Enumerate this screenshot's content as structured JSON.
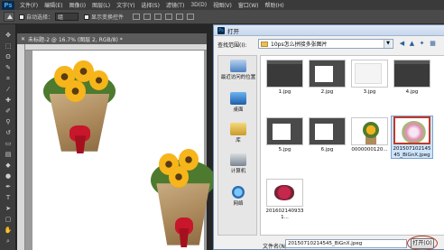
{
  "ps": {
    "logo": "Ps",
    "menu": [
      "文件(F)",
      "编辑(E)",
      "图像(I)",
      "图层(L)",
      "文字(Y)",
      "选择(S)",
      "滤镜(T)",
      "3D(D)",
      "视图(V)",
      "窗口(W)",
      "帮助(H)"
    ],
    "options": {
      "auto_select_label": "自动选择：",
      "auto_select_value": "组",
      "transform_label": "显示变换控件"
    },
    "document_tab": "未标题-2 @ 16.7% (图层 2, RGB/8) *"
  },
  "dialog": {
    "title": "打开",
    "look_in_label": "查找范围(I):",
    "current_folder": "10ps怎么拼接多张图片",
    "places": [
      {
        "label": "最近访问的位置",
        "icon": "recent-places-icon"
      },
      {
        "label": "桌面",
        "icon": "desktop-icon"
      },
      {
        "label": "库",
        "icon": "library-icon"
      },
      {
        "label": "计算机",
        "icon": "computer-icon"
      },
      {
        "label": "网络",
        "icon": "network-icon"
      }
    ],
    "files": [
      {
        "name": "1.jpg",
        "thumb": "dark"
      },
      {
        "name": "2.jpg",
        "thumb": "ps-shot"
      },
      {
        "name": "3.jpg",
        "thumb": "blank"
      },
      {
        "name": "4.jpg",
        "thumb": "dark"
      },
      {
        "name": "5.jpg",
        "thumb": "ps-shot"
      },
      {
        "name": "6.jpg",
        "thumb": "ps-shot"
      },
      {
        "name": "0000000120...",
        "thumb": "photo"
      },
      {
        "name": "20150710214545_BiGnX.jpeg",
        "thumb": "round",
        "selected": true
      },
      {
        "name": "2016021409331...",
        "thumb": "roses"
      }
    ],
    "filename_label": "文件名(N):",
    "filename_value": "20150710214545_BiGnX.jpeg",
    "open_button": "打开(O)"
  }
}
